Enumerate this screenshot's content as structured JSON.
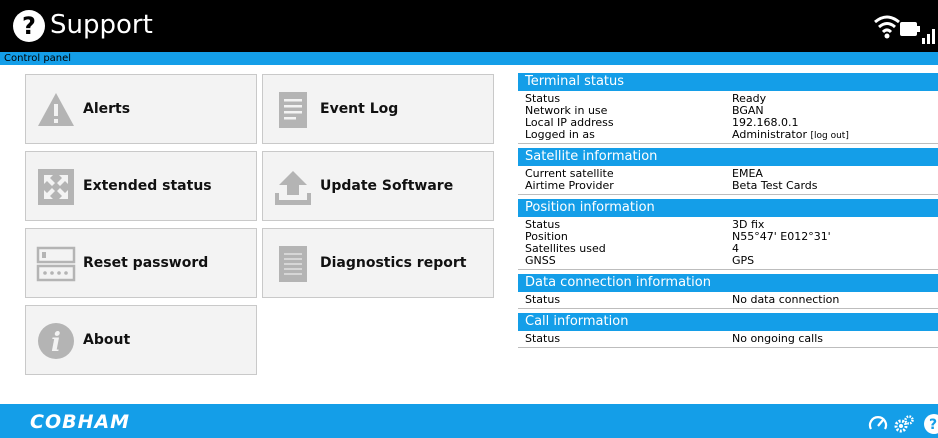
{
  "header": {
    "title": "Support",
    "breadcrumb": "Control panel"
  },
  "tiles": [
    {
      "label": "Alerts",
      "icon": "warning-icon"
    },
    {
      "label": "Event Log",
      "icon": "document-icon"
    },
    {
      "label": "Extended status",
      "icon": "expand-icon"
    },
    {
      "label": "Update Software",
      "icon": "upload-icon"
    },
    {
      "label": "Reset password",
      "icon": "keypad-icon"
    },
    {
      "label": "Diagnostics report",
      "icon": "report-icon"
    },
    {
      "label": "About",
      "icon": "info-icon"
    }
  ],
  "terminal_status": {
    "title": "Terminal status",
    "rows": [
      {
        "key": "Status",
        "value": "Ready"
      },
      {
        "key": "Network in use",
        "value": "BGAN"
      },
      {
        "key": "Local IP address",
        "value": "192.168.0.1"
      },
      {
        "key": "Logged in as",
        "value": "Administrator",
        "link": "[log out]"
      }
    ]
  },
  "satellite_info": {
    "title": "Satellite information",
    "rows": [
      {
        "key": "Current satellite",
        "value": "EMEA"
      },
      {
        "key": "Airtime Provider",
        "value": "Beta Test Cards"
      }
    ]
  },
  "position_info": {
    "title": "Position information",
    "rows": [
      {
        "key": "Status",
        "value": "3D fix"
      },
      {
        "key": "Position",
        "value": "N55°47' E012°31'"
      },
      {
        "key": "Satellites used",
        "value": "4"
      },
      {
        "key": "GNSS",
        "value": "GPS"
      }
    ]
  },
  "data_connection": {
    "title": "Data connection information",
    "rows": [
      {
        "key": "Status",
        "value": "No data connection"
      }
    ]
  },
  "call_info": {
    "title": "Call information",
    "rows": [
      {
        "key": "Status",
        "value": "No ongoing calls"
      }
    ]
  },
  "footer": {
    "brand": "COBHAM"
  },
  "colors": {
    "accent": "#149ee8",
    "topbar": "#000000",
    "tile_bg": "#f3f3f3",
    "icon_gray": "#b4b4b4"
  }
}
